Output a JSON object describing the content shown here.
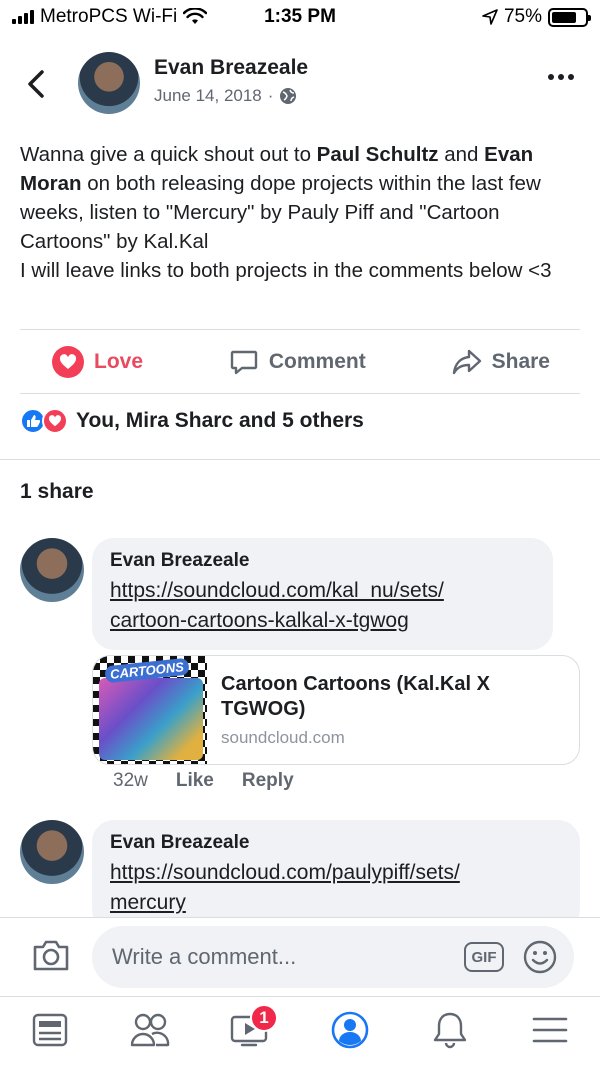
{
  "status_bar": {
    "carrier": "MetroPCS Wi-Fi",
    "time": "1:35 PM",
    "battery": "75%",
    "battery_level": 0.75
  },
  "post": {
    "author": "Evan Breazeale",
    "date": "June 14, 2018",
    "text": {
      "t1": "Wanna give a quick shout out to ",
      "mention1": "Paul Schultz",
      "t2": " and ",
      "mention2": "Evan Moran",
      "t3": " on both releasing dope projects within the last few weeks, listen to \"Mercury\" by Pauly Piff and \"Cartoon Cartoons\" by Kal.Kal",
      "t4": "I will leave links to both projects in the comments below <3"
    },
    "actions": {
      "love": "Love",
      "comment": "Comment",
      "share": "Share"
    },
    "reactions_text": "You, Mira Sharc and 5 others",
    "shares_text": "1 share"
  },
  "comments": [
    {
      "author": "Evan Breazeale",
      "link_line1": "https://soundcloud.com/kal_nu/sets/",
      "link_line2": "cartoon-cartoons-kalkal-x-tgwog",
      "preview": {
        "thumb_label": "CARTOONS",
        "title": "Cartoon Cartoons (Kal.Kal X TGWOG)",
        "domain": "soundcloud.com"
      },
      "age": "32w",
      "like": "Like",
      "reply": "Reply"
    },
    {
      "author": "Evan Breazeale",
      "link_line1": "https://soundcloud.com/paulypiff/sets/",
      "link_line2": "mercury"
    }
  ],
  "composer": {
    "placeholder": "Write a comment...",
    "gif_label": "GIF"
  },
  "tab_bar": {
    "items": [
      "news-feed-icon",
      "friends-icon",
      "watch-icon",
      "profile-icon",
      "notifications-icon",
      "menu-icon"
    ],
    "watch_badge": "1",
    "active_color": "#1877f2",
    "inactive_color": "#606770"
  },
  "colors": {
    "love": "#f33e58",
    "like": "#1877f2",
    "bubble": "#f0f2f5"
  }
}
